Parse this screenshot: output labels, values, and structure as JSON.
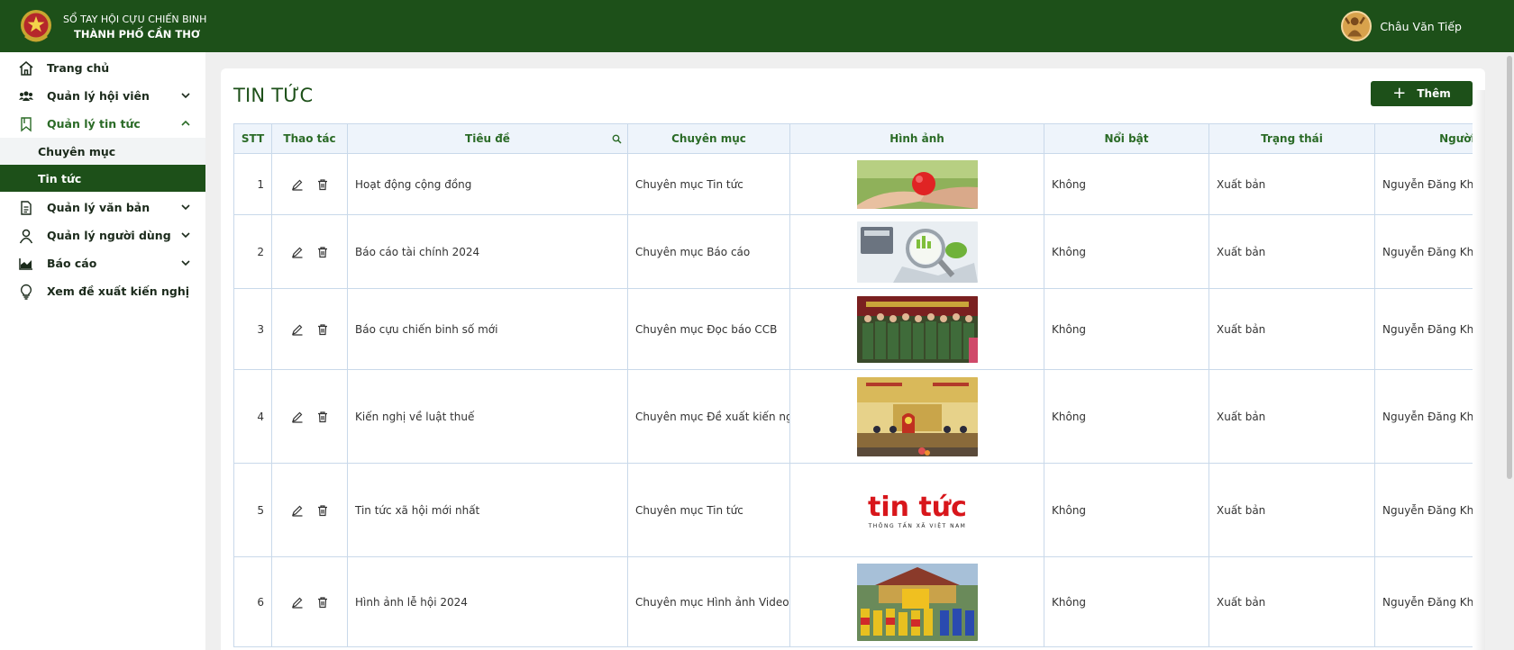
{
  "header": {
    "brand_line1": "SỔ TAY HỘI CỰU CHIẾN BINH",
    "brand_line2": "THÀNH PHỐ CẦN THƠ",
    "user_name": "Châu Văn Tiếp",
    "bg_color": "#1d5019"
  },
  "sidebar": {
    "items": [
      {
        "label": "Trang chủ",
        "icon": "home-icon"
      },
      {
        "label": "Quản lý hội viên",
        "icon": "users-icon"
      },
      {
        "label": "Quản lý tin tức",
        "icon": "bookmark-icon"
      },
      {
        "label": "Quản lý văn bản",
        "icon": "document-icon"
      },
      {
        "label": "Quản lý người dùng",
        "icon": "user-icon"
      },
      {
        "label": "Báo cáo",
        "icon": "chart-icon"
      },
      {
        "label": "Xem đề xuất kiến nghị",
        "icon": "lightbulb-icon"
      }
    ],
    "news_sub": [
      {
        "label": "Chuyên mục"
      },
      {
        "label": "Tin tức"
      }
    ]
  },
  "main": {
    "title": "TIN TỨC",
    "add_label": "Thêm",
    "columns": [
      "STT",
      "Thao tác",
      "Tiêu đề",
      "Chuyên mục",
      "Hình ảnh",
      "Nổi bật",
      "Trạng thái",
      "Người tạo"
    ],
    "rows": [
      {
        "stt": "1",
        "title": "Hoạt động cộng đồng",
        "category": "Chuyên mục Tin tức",
        "image": "hands-heart-image",
        "featured": "Không",
        "status": "Xuất bản",
        "author": "Nguyễn Đăng Khoa"
      },
      {
        "stt": "2",
        "title": "Báo cáo tài chính 2024",
        "category": "Chuyên mục Báo cáo",
        "image": "finance-report-image",
        "featured": "Không",
        "status": "Xuất bản",
        "author": "Nguyễn Đăng Khoa"
      },
      {
        "stt": "3",
        "title": "Báo cựu chiến binh số mới",
        "category": "Chuyên mục Đọc báo CCB",
        "image": "veterans-group-image",
        "featured": "Không",
        "status": "Xuất bản",
        "author": "Nguyễn Đăng Khoa"
      },
      {
        "stt": "4",
        "title": "Kiến nghị về luật thuế",
        "category": "Chuyên mục Đề xuất kiến nghị",
        "image": "assembly-hall-image",
        "featured": "Không",
        "status": "Xuất bản",
        "author": "Nguyễn Đăng Khoa"
      },
      {
        "stt": "5",
        "title": "Tin tức xã hội mới nhất",
        "category": "Chuyên mục Tin tức",
        "image": "tin-tuc-logo-image",
        "image_text": "tin tức",
        "image_subtext": "THÔNG TẤN XÃ VIỆT NAM",
        "featured": "Không",
        "status": "Xuất bản",
        "author": "Nguyễn Đăng Khoa"
      },
      {
        "stt": "6",
        "title": "Hình ảnh lễ hội 2024",
        "category": "Chuyên mục Hình ảnh Video",
        "image": "festival-image",
        "featured": "Không",
        "status": "Xuất bản",
        "author": "Nguyễn Đăng Khoa"
      }
    ]
  }
}
